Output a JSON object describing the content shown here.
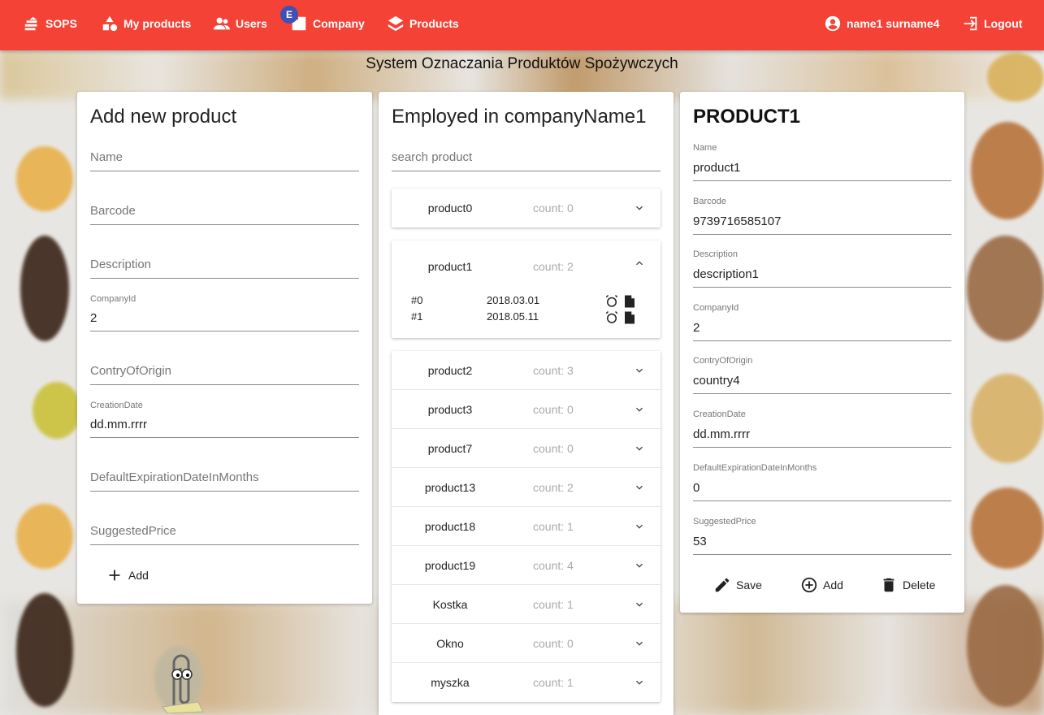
{
  "nav": {
    "brand": "SOPS",
    "my_products": "My products",
    "users": "Users",
    "company": "Company",
    "company_badge": "E",
    "products": "Products",
    "user_name": "name1 surname4",
    "logout": "Logout"
  },
  "page_title": "System Oznaczania Produktów Spożywczych",
  "add_form": {
    "title": "Add new product",
    "name_placeholder": "Name",
    "barcode_placeholder": "Barcode",
    "description_placeholder": "Description",
    "companyid_label": "CompanyId",
    "companyid_value": "2",
    "country_placeholder": "ContryOfOrigin",
    "creation_label": "CreationDate",
    "creation_value": "dd.mm.rrrr",
    "expiration_placeholder": "DefaultExpirationDateInMonths",
    "price_placeholder": "SuggestedPrice",
    "add_label": "Add"
  },
  "company_list": {
    "title": "Employed in companyName1",
    "search_placeholder": "search product",
    "products": [
      {
        "name": "product0",
        "count": "count: 0"
      },
      {
        "name": "product1",
        "count": "count: 2"
      },
      {
        "name": "product2",
        "count": "count: 3"
      },
      {
        "name": "product3",
        "count": "count: 0"
      },
      {
        "name": "product7",
        "count": "count: 0"
      },
      {
        "name": "product13",
        "count": "count: 2"
      },
      {
        "name": "product18",
        "count": "count: 1"
      },
      {
        "name": "product19",
        "count": "count: 4"
      },
      {
        "name": "Kostka",
        "count": "count: 1"
      },
      {
        "name": "Okno",
        "count": "count: 0"
      },
      {
        "name": "myszka",
        "count": "count: 1"
      }
    ],
    "expanded_items": [
      {
        "index": "#0",
        "date": "2018.03.01"
      },
      {
        "index": "#1",
        "date": "2018.05.11"
      }
    ]
  },
  "detail": {
    "title": "PRODUCT1",
    "fields": [
      {
        "label": "Name",
        "value": "product1"
      },
      {
        "label": "Barcode",
        "value": "9739716585107"
      },
      {
        "label": "Description",
        "value": "description1"
      },
      {
        "label": "CompanyId",
        "value": "2"
      },
      {
        "label": "ContryOfOrigin",
        "value": "country4"
      },
      {
        "label": "CreationDate",
        "value": "dd.mm.rrrr"
      },
      {
        "label": "DefaultExpirationDateInMonths",
        "value": "0"
      },
      {
        "label": "SuggestedPrice",
        "value": "53"
      }
    ],
    "save_label": "Save",
    "add_label": "Add",
    "delete_label": "Delete"
  },
  "colors": {
    "accent": "#f44336",
    "badge": "#3f51b5"
  }
}
